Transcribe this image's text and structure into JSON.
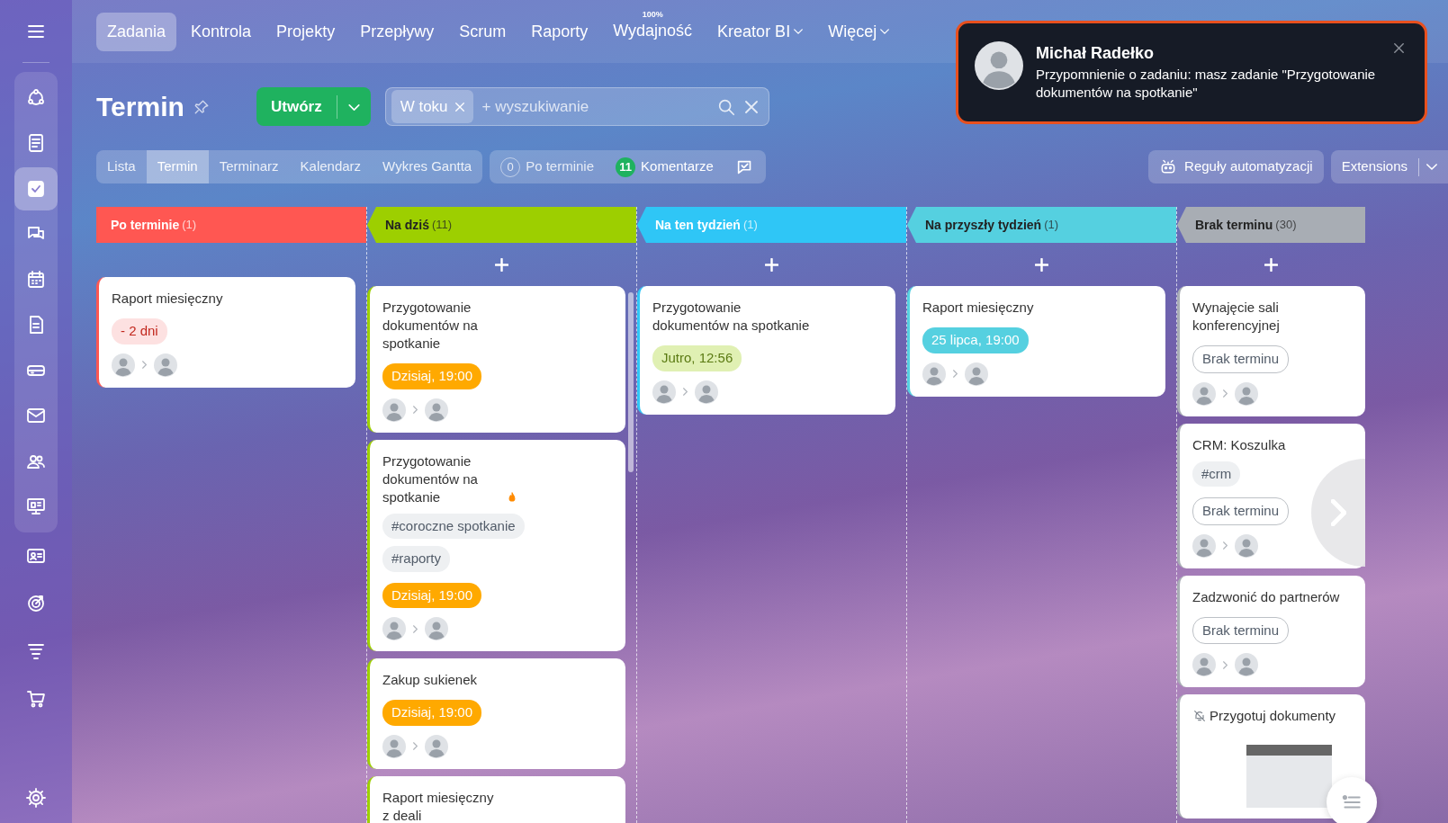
{
  "sidebar": {
    "items": [
      {
        "selected": false
      },
      {
        "selected": false
      },
      {
        "selected": true
      },
      {
        "selected": false
      },
      {
        "selected": false
      },
      {
        "selected": false
      },
      {
        "selected": false
      },
      {
        "selected": false
      },
      {
        "selected": false
      },
      {
        "selected": false
      },
      {
        "selected": false
      },
      {
        "selected": false
      },
      {
        "selected": false
      },
      {
        "selected": false
      }
    ]
  },
  "nav": {
    "tabs": [
      {
        "label": "Zadania",
        "selected": true,
        "dropdown": false
      },
      {
        "label": "Kontrola",
        "selected": false,
        "dropdown": false
      },
      {
        "label": "Projekty",
        "selected": false,
        "dropdown": false
      },
      {
        "label": "Przepływy",
        "selected": false,
        "dropdown": false
      },
      {
        "label": "Scrum",
        "selected": false,
        "dropdown": false
      },
      {
        "label": "Raporty",
        "selected": false,
        "dropdown": false
      },
      {
        "label": "Wydajność",
        "selected": false,
        "dropdown": false,
        "badge": "100%"
      },
      {
        "label": "Kreator BI",
        "selected": false,
        "dropdown": true
      },
      {
        "label": "Więcej",
        "selected": false,
        "dropdown": true
      }
    ]
  },
  "toolbar": {
    "title": "Termin",
    "create": "Utwórz",
    "filter_chip": "W toku",
    "search_placeholder": "+ wyszukiwanie"
  },
  "views": [
    {
      "label": "Lista",
      "selected": false
    },
    {
      "label": "Termin",
      "selected": true
    },
    {
      "label": "Terminarz",
      "selected": false
    },
    {
      "label": "Kalendarz",
      "selected": false
    },
    {
      "label": "Wykres Gantta",
      "selected": false
    }
  ],
  "counters": [
    {
      "count": "0",
      "label": "Po terminie",
      "kind": "zero"
    },
    {
      "count": "11",
      "label": "Komentarze",
      "kind": "active"
    }
  ],
  "automation": "Reguły automatyzacji",
  "extensions": "Extensions",
  "columns": [
    {
      "title": "Po terminie",
      "count": "(1)",
      "color": "#ff5752",
      "add_button": false,
      "scrollbar": false,
      "cards": [
        {
          "title": "Raport miesięczny",
          "deadline": {
            "text": "- 2 dni",
            "kind": "overdue"
          }
        }
      ]
    },
    {
      "title": "Na dziś",
      "count": "(11)",
      "color": "#9dcf00",
      "add_button": true,
      "scrollbar": true,
      "cards": [
        {
          "title": "Przygotowanie dokumentów na spotkanie",
          "deadline": {
            "text": "Dzisiaj, 19:00",
            "kind": "today"
          }
        },
        {
          "title": "Przygotowanie dokumentów na spotkanie",
          "hot": true,
          "tags": [
            "#coroczne spotkanie",
            "#raporty"
          ],
          "deadline": {
            "text": "Dzisiaj, 19:00",
            "kind": "today"
          }
        },
        {
          "title": "Zakup sukienek",
          "deadline": {
            "text": "Dzisiaj, 19:00",
            "kind": "today"
          }
        },
        {
          "title": "Raport miesięczny z deali"
        }
      ]
    },
    {
      "title": "Na ten tydzień",
      "count": "(1)",
      "color": "#2fc6f6",
      "add_button": true,
      "scrollbar": false,
      "cards": [
        {
          "title": "Przygotowanie dokumentów na spotkanie",
          "deadline": {
            "text": "Jutro, 12:56",
            "kind": "tomorrow"
          }
        }
      ]
    },
    {
      "title": "Na przyszły tydzień",
      "count": "(1)",
      "color": "#55d0e0",
      "add_button": true,
      "scrollbar": false,
      "cards": [
        {
          "title": "Raport miesięczny",
          "deadline": {
            "text": "25 lipca, 19:00",
            "kind": "week"
          }
        }
      ]
    },
    {
      "title": "Brak terminu",
      "count": "(30)",
      "color": "#a8adb4",
      "add_button": true,
      "scrollbar": false,
      "cards": [
        {
          "title": "Wynajęcie sali konferencyjnej",
          "deadline": {
            "text": "Brak terminu",
            "kind": "none"
          }
        },
        {
          "title": "CRM: Koszulka",
          "tags": [
            "#crm"
          ],
          "deadline": {
            "text": "Brak terminu",
            "kind": "none"
          }
        },
        {
          "title": "Zadzwonić do partnerów",
          "deadline": {
            "text": "Brak terminu",
            "kind": "none"
          }
        },
        {
          "title": "Przygotuj dokumenty",
          "muted": true,
          "preview": true
        }
      ]
    }
  ],
  "notification": {
    "name": "Michał Radełko",
    "text": "Przypomnienie o zadaniu: masz zadanie \"Przygotowanie dokumentów na spotkanie\""
  }
}
